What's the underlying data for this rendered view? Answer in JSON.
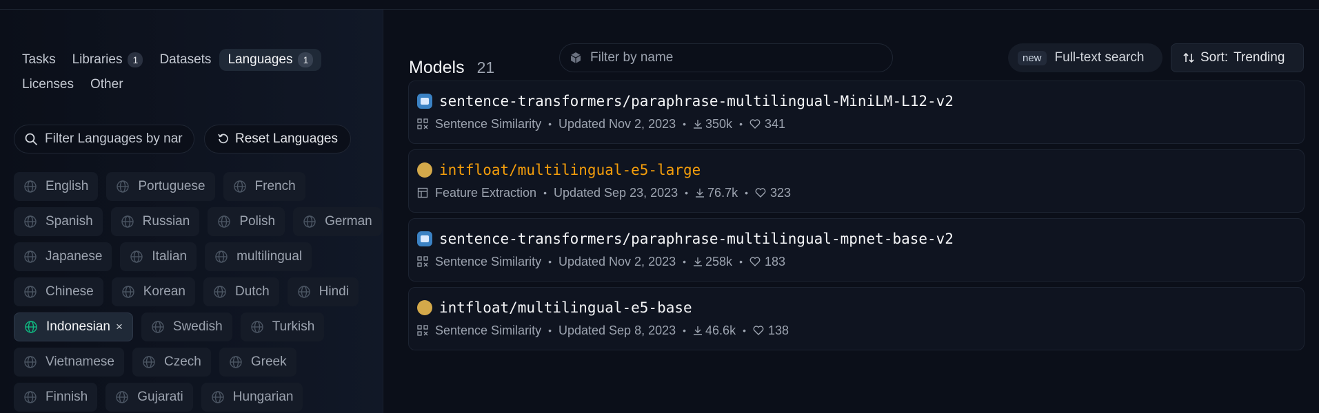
{
  "sidebar": {
    "tabs_row1": [
      {
        "label": "Tasks",
        "badge": null
      },
      {
        "label": "Libraries",
        "badge": "1"
      },
      {
        "label": "Datasets",
        "badge": null
      },
      {
        "label": "Languages",
        "badge": "1",
        "active": true
      }
    ],
    "tabs_row2": [
      {
        "label": "Licenses"
      },
      {
        "label": "Other"
      }
    ],
    "filter_placeholder": "Filter Languages by name",
    "filter_visible_text": "Filter Languages by nar",
    "reset_label": "Reset Languages",
    "languages": [
      [
        "English",
        "Portuguese",
        "French"
      ],
      [
        "Spanish",
        "Russian",
        "Polish",
        "German"
      ],
      [
        "Japanese",
        "Italian",
        "multilingual"
      ],
      [
        "Chinese",
        "Korean",
        "Dutch",
        "Hindi"
      ],
      [
        "Indonesian",
        "Swedish",
        "Turkish"
      ],
      [
        "Vietnamese",
        "Czech",
        "Greek"
      ],
      [
        "Finnish",
        "Gujarati",
        "Hungarian"
      ]
    ],
    "selected_language": "Indonesian",
    "selected_remove_symbol": "×"
  },
  "main": {
    "title": "Models",
    "count": "21",
    "name_filter_placeholder": "Filter by name",
    "new_badge": "new",
    "fulltext_label": "Full-text search",
    "sort_label": "Sort:",
    "sort_value": "Trending",
    "models": [
      {
        "name": "sentence-transformers/paraphrase-multilingual-MiniLM-L12-v2",
        "task": "Sentence Similarity",
        "updated": "Updated Nov 2, 2023",
        "downloads": "350k",
        "likes": "341",
        "avatar": "sbert",
        "task_icon": "qr-icon",
        "accent": false
      },
      {
        "name": "intfloat/multilingual-e5-large",
        "task": "Feature Extraction",
        "updated": "Updated Sep 23, 2023",
        "downloads": "76.7k",
        "likes": "323",
        "avatar": "intfloat",
        "task_icon": "table-icon",
        "accent": true
      },
      {
        "name": "sentence-transformers/paraphrase-multilingual-mpnet-base-v2",
        "task": "Sentence Similarity",
        "updated": "Updated Nov 2, 2023",
        "downloads": "258k",
        "likes": "183",
        "avatar": "sbert",
        "task_icon": "qr-icon",
        "accent": false
      },
      {
        "name": "intfloat/multilingual-e5-base",
        "task": "Sentence Similarity",
        "updated": "Updated Sep 8, 2023",
        "downloads": "46.6k",
        "likes": "138",
        "avatar": "intfloat",
        "task_icon": "qr-icon",
        "accent": false
      }
    ],
    "separator": "•"
  },
  "colors": {
    "background": "#0b0f19",
    "accent_orange": "#f59e0b",
    "selected_globe": "#10b981"
  }
}
